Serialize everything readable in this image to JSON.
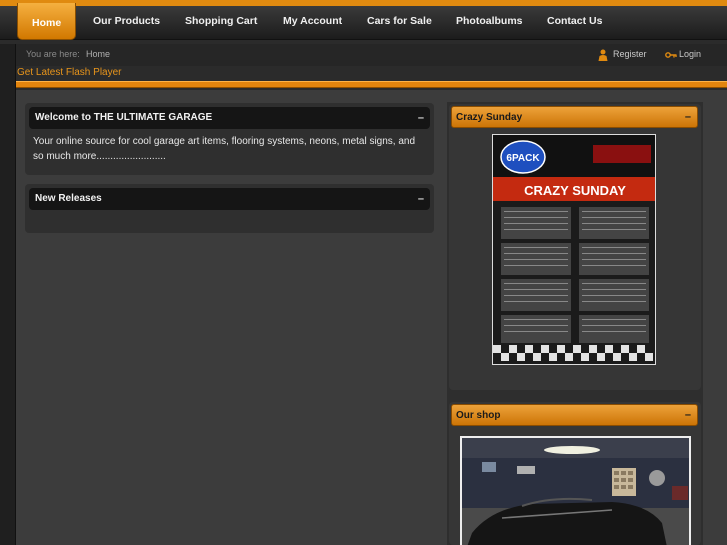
{
  "nav": {
    "items": [
      "Home",
      "Our Products",
      "Shopping Cart",
      "My Account",
      "Cars for Sale",
      "Photoalbums",
      "Contact Us"
    ],
    "active_index": 0
  },
  "breadcrumb": {
    "prefix": "You are here:",
    "current": "Home"
  },
  "user_links": {
    "register": "Register",
    "login": "Login"
  },
  "flash_link": "Get Latest Flash Player",
  "modules": {
    "welcome": {
      "title": "Welcome to THE ULTIMATE GARAGE",
      "minimize": "–",
      "text_line1": "Your online source for cool garage art items, flooring systems, neons, metal signs, and",
      "text_line2": "so much more........................."
    },
    "new_releases": {
      "title": "New Releases",
      "minimize": "–"
    }
  },
  "sidebar": {
    "crazy_sunday": {
      "title": "Crazy Sunday",
      "minimize": "–",
      "poster": {
        "logo": "6PACK",
        "headline": "CRAZY SUNDAY"
      }
    },
    "our_shop": {
      "title": "Our shop",
      "minimize": "–"
    }
  },
  "colors": {
    "accent": "#e3850e",
    "background": "#3c3c3c",
    "header": "#151515"
  },
  "icons": {
    "register": "user-icon",
    "login": "key-icon",
    "minimize": "minus-icon"
  }
}
